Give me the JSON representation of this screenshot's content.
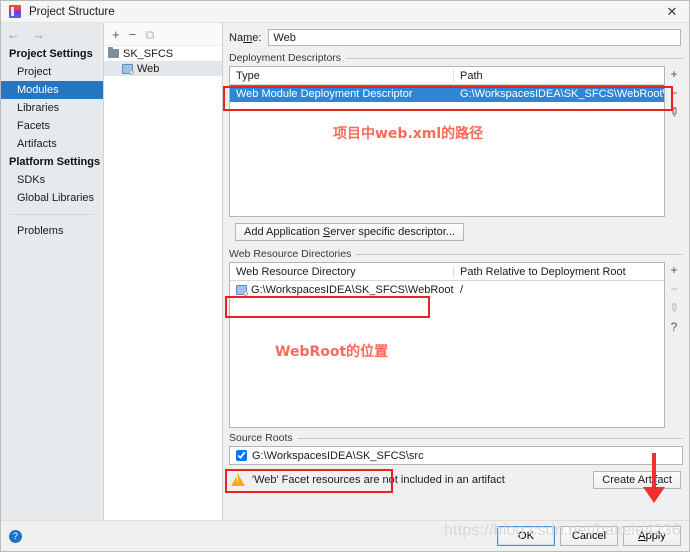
{
  "window": {
    "title": "Project Structure",
    "close_label": "✕",
    "app_icon": "intellij-idea-icon"
  },
  "leftnav": {
    "back_icon": "←",
    "forward_icon": "→",
    "groups": [
      {
        "title": "Project Settings",
        "items": [
          {
            "label": "Project",
            "selected": false
          },
          {
            "label": "Modules",
            "selected": true
          },
          {
            "label": "Libraries",
            "selected": false
          },
          {
            "label": "Facets",
            "selected": false
          },
          {
            "label": "Artifacts",
            "selected": false
          }
        ]
      },
      {
        "title": "Platform Settings",
        "items": [
          {
            "label": "SDKs",
            "selected": false
          },
          {
            "label": "Global Libraries",
            "selected": false
          }
        ]
      }
    ],
    "problems_label": "Problems"
  },
  "tree": {
    "toolbar": {
      "add": "+",
      "remove": "−",
      "copy": "⧉"
    },
    "nodes": [
      {
        "label": "SK_SFCS",
        "icon": "folder-icon",
        "selected": false
      },
      {
        "label": "Web",
        "icon": "web-facet-icon",
        "selected": true
      }
    ]
  },
  "detail": {
    "name_label_pre": "Na",
    "name_label_mnemonic": "m",
    "name_label_post": "e:",
    "name_value": "Web",
    "name_placeholder": "",
    "deployment_descriptors": {
      "group_title": "Deployment Descriptors",
      "columns": [
        "Type",
        "Path"
      ],
      "rows": [
        {
          "type": "Web Module Deployment Descriptor",
          "path": "G:\\WorkspacesIDEA\\SK_SFCS\\WebRoot\\WEB-INF\\web.x",
          "selected": true
        }
      ],
      "tools": {
        "add": "+",
        "remove": "−",
        "edit": "✎"
      },
      "add_button_pre": "Add Application ",
      "add_button_mnemonic": "S",
      "add_button_post": "erver specific descriptor..."
    },
    "web_resource_directories": {
      "group_title": "Web Resource Directories",
      "columns": [
        "Web Resource Directory",
        "Path Relative to Deployment Root"
      ],
      "rows": [
        {
          "directory": "G:\\WorkspacesIDEA\\SK_SFCS\\WebRoot",
          "relative": "/"
        }
      ],
      "tools": {
        "add": "+",
        "remove": "−",
        "edit": "✎",
        "help": "?"
      }
    },
    "source_roots": {
      "group_title": "Source Roots",
      "rows": [
        {
          "path": "G:\\WorkspacesIDEA\\SK_SFCS\\src",
          "checked": true
        }
      ]
    },
    "warning": {
      "icon": "warning-triangle-icon",
      "text": "'Web' Facet resources are not included in an artifact",
      "action_pre": "Create Arti",
      "action_mnemonic": "f",
      "action_post": "act"
    }
  },
  "footer": {
    "help_icon": "?",
    "buttons": [
      {
        "label": "OK",
        "default": true
      },
      {
        "label": "Cancel",
        "default": false
      },
      {
        "label": "Apply",
        "default": false,
        "mnemonic": "A"
      }
    ]
  },
  "annotations": {
    "note_webxml": "项目中web.xml的路径",
    "note_webroot": "WebRoot的位置",
    "highlight_color": "#ee1f1f",
    "note_color": "#fd6a5c",
    "arrow_target": "Create Artifact"
  },
  "watermark": {
    "text": "https://blog.csdn.net/hakele4236"
  }
}
